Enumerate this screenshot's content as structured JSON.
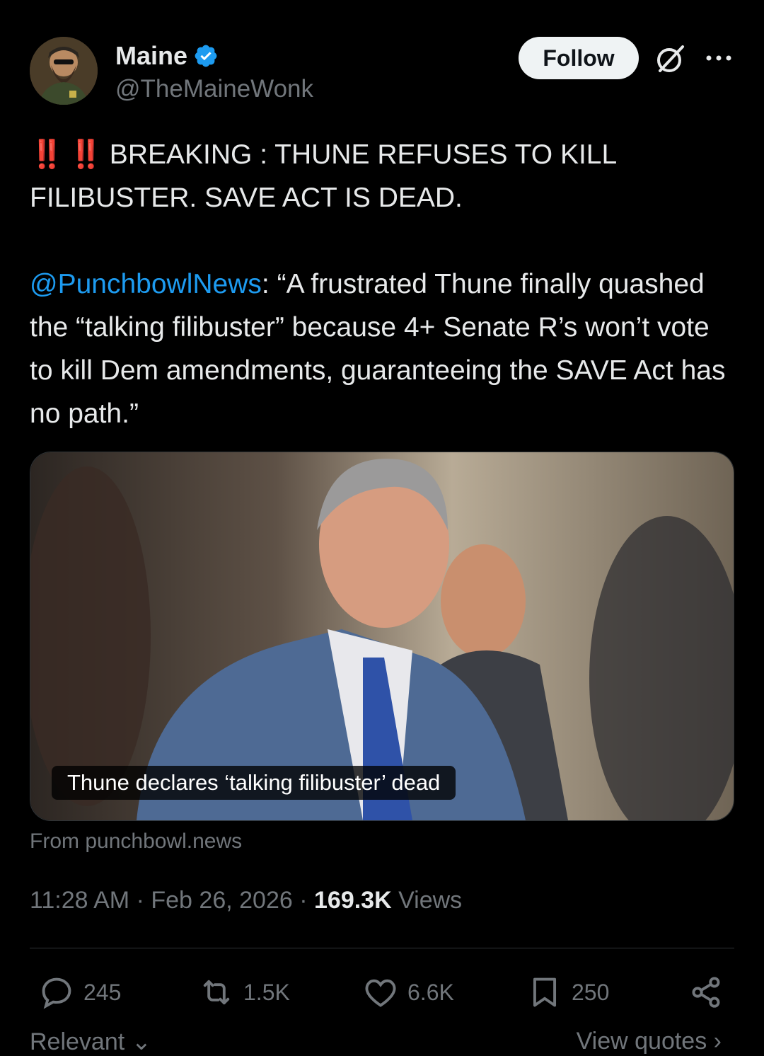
{
  "author": {
    "name": "Maine",
    "handle": "@TheMaineWonk",
    "verified_color": "#1d9bf0"
  },
  "header": {
    "follow_label": "Follow",
    "grok_icon": "grok-icon",
    "more_icon": "more-icon"
  },
  "tweet": {
    "alert_emoji": "‼️ ‼️",
    "headline": " BREAKING : THUNE REFUSES TO KILL\nFILIBUSTER. SAVE ACT IS DEAD.",
    "mention": "@PunchbowlNews",
    "quote": ": “A frustrated Thune finally quashed the “talking filibuster” because 4+ Senate R’s won’t vote to kill Dem amendments, guaranteeing the SAVE Act has no path.”"
  },
  "card": {
    "caption": "Thune declares ‘talking filibuster’ dead",
    "source": "From punchbowl.news"
  },
  "meta": {
    "time": "11:28 AM",
    "date": "Feb 26, 2026",
    "views_count": "169.3K",
    "views_label": "Views"
  },
  "actions": {
    "replies": "245",
    "reposts": "1.5K",
    "likes": "6.6K",
    "bookmarks": "250"
  },
  "footer": {
    "left": "Relevant",
    "right": "View quotes"
  },
  "colors": {
    "background": "#000000",
    "text": "#e7e9ea",
    "muted": "#71767b",
    "accent": "#1d9bf0",
    "alert": "#e0245e"
  }
}
